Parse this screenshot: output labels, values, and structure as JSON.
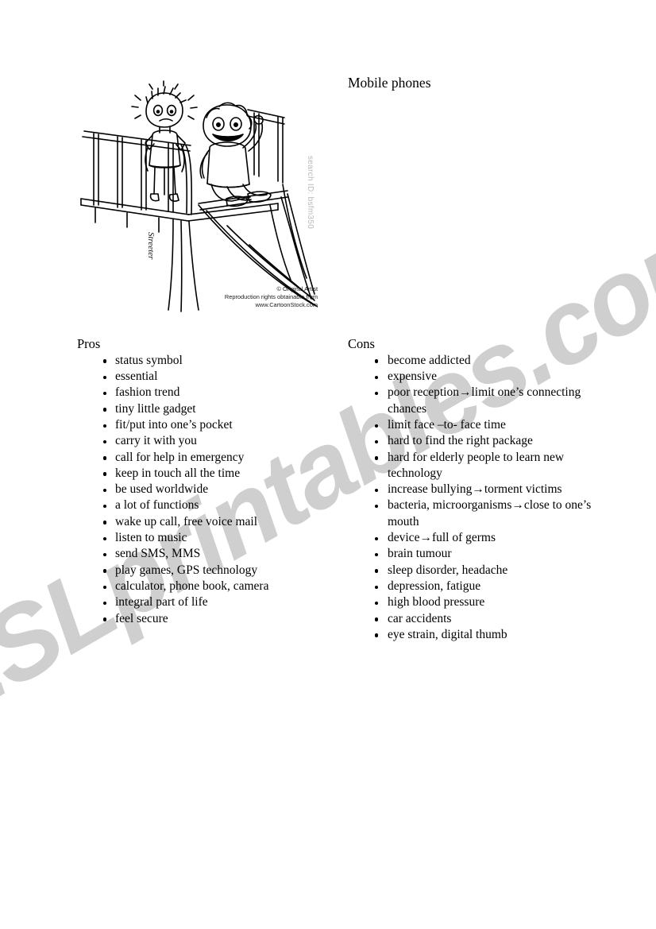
{
  "document": {
    "title": "Mobile phones",
    "watermark": "ESLprintables.com"
  },
  "cartoon": {
    "alt_name": "playground-slide-cartoon",
    "search_id": "search ID: bsfm350",
    "signature": "Streeter",
    "credit_lines": [
      "© Original Artist",
      "Reproduction rights obtainable from",
      "www.CartoonStock.com"
    ]
  },
  "pros": {
    "heading": "Pros",
    "items": [
      "status symbol",
      "essential",
      "fashion trend",
      "tiny little gadget",
      "fit/put into one’s pocket",
      "carry it with you",
      "call for help in emergency",
      "keep in touch all the time",
      "be used worldwide",
      "a lot of functions",
      "wake up call, free voice mail",
      "listen to music",
      "send SMS, MMS",
      "play games, GPS technology",
      "calculator, phone book, camera",
      "integral part of life",
      "feel secure"
    ]
  },
  "cons": {
    "heading": "Cons",
    "items": [
      "become addicted",
      "expensive",
      "poor reception→limit one’s connecting chances",
      "limit face –to- face time",
      "hard to find the right package",
      "hard for elderly people to learn new technology",
      "increase bullying→torment victims",
      "bacteria, microorganisms→close to one’s mouth",
      "device→full of germs",
      "brain tumour",
      "sleep disorder, headache",
      "depression, fatigue",
      "high blood pressure",
      "car accidents",
      "eye strain, digital thumb"
    ]
  },
  "colors": {
    "page_background": "#ffffff",
    "text": "#000000",
    "watermark": "#cfcfcf",
    "search_id": "#b8b8b8"
  }
}
